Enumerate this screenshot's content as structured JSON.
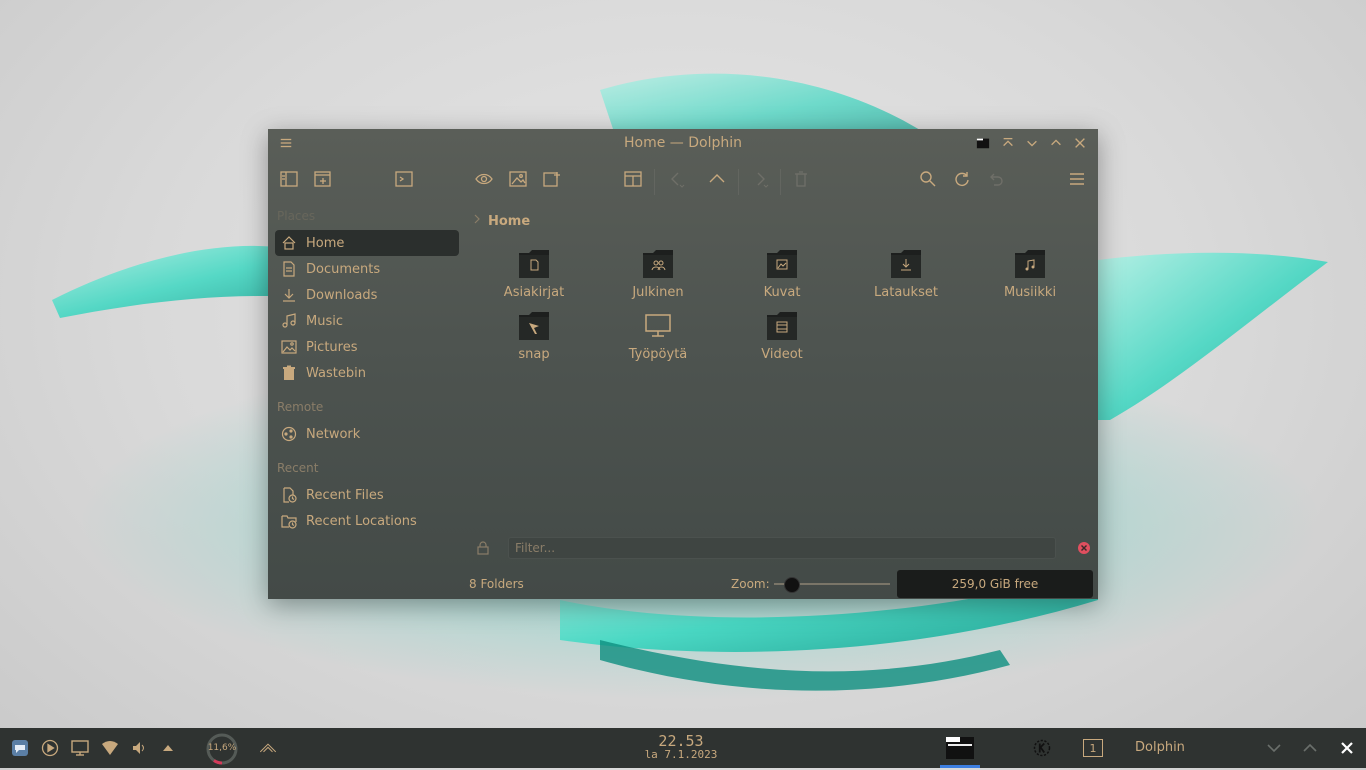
{
  "colors": {
    "accent_text": "#c8a97e",
    "window_bg": "#4e5450",
    "taskbar_bg": "#2f3331",
    "wallpaper_teal": "#33d6bf",
    "active_place_bg": "#2b2f2d",
    "close_red": "#e04f5f"
  },
  "window": {
    "title": "Home — Dolphin",
    "titlebar_buttons": [
      "app-icon",
      "keep-above-icon",
      "minimize-icon",
      "maximize-icon",
      "close-icon"
    ]
  },
  "toolbar": {
    "icons": [
      "places-panel-icon",
      "new-window-icon",
      "terminal-icon",
      "preview-icon",
      "image-view-icon",
      "new-tab-icon",
      "split-view-icon",
      "back-icon",
      "up-icon",
      "forward-icon",
      "trash-icon",
      "search-icon",
      "refresh-icon",
      "undo-icon",
      "hamburger-menu-icon"
    ]
  },
  "places": {
    "section_places": "Places",
    "items": [
      {
        "label": "Home",
        "icon": "home-icon",
        "active": true
      },
      {
        "label": "Documents",
        "icon": "documents-icon"
      },
      {
        "label": "Downloads",
        "icon": "downloads-icon"
      },
      {
        "label": "Music",
        "icon": "music-icon"
      },
      {
        "label": "Pictures",
        "icon": "pictures-icon"
      },
      {
        "label": "Wastebin",
        "icon": "wastebin-icon"
      }
    ],
    "section_remote": "Remote",
    "remote_items": [
      {
        "label": "Network",
        "icon": "network-icon"
      }
    ],
    "section_recent": "Recent",
    "recent_items": [
      {
        "label": "Recent Files",
        "icon": "recent-files-icon"
      },
      {
        "label": "Recent Locations",
        "icon": "recent-locations-icon"
      }
    ]
  },
  "breadcrumb": {
    "current": "Home"
  },
  "files": [
    {
      "name": "Asiakirjat",
      "icon": "folder-documents-icon"
    },
    {
      "name": "Julkinen",
      "icon": "folder-public-icon"
    },
    {
      "name": "Kuvat",
      "icon": "folder-pictures-icon"
    },
    {
      "name": "Lataukset",
      "icon": "folder-downloads-icon"
    },
    {
      "name": "Musiikki",
      "icon": "folder-music-icon"
    },
    {
      "name": "snap",
      "icon": "folder-snap-icon"
    },
    {
      "name": "Työpöytä",
      "icon": "desktop-icon"
    },
    {
      "name": "Videot",
      "icon": "folder-videos-icon"
    }
  ],
  "filter": {
    "placeholder": "Filter...",
    "value": ""
  },
  "status": {
    "count": "8 Folders",
    "zoom_label": "Zoom:",
    "zoom_level": 0.1,
    "free_space": "259,0 GiB free"
  },
  "taskbar": {
    "cpu_text": "11,6%",
    "clock_time": "22.53",
    "clock_date": "la 7.1.2023",
    "pager_number": "1",
    "active_window_title": "Dolphin"
  }
}
